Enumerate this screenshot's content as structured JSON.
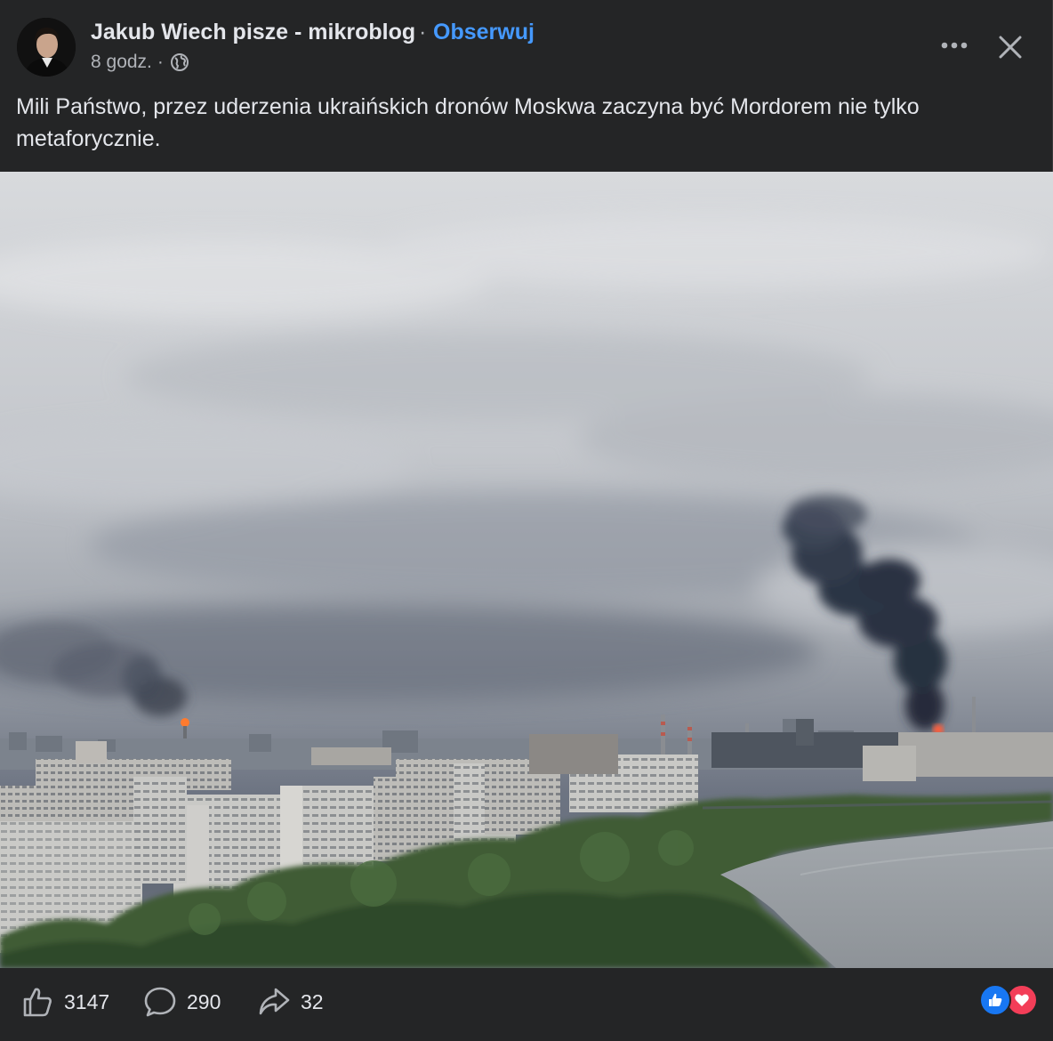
{
  "post": {
    "author": "Jakub Wiech pisze - mikroblog",
    "separator": "·",
    "follow_label": "Obserwuj",
    "time": "8 godz.",
    "meta_separator": "·",
    "audience_icon": "globe-icon",
    "text": "Mili Państwo, przez uderzenia ukraińskich dronów Moskwa zaczyna być Mordorem nie tylko metaforycznie."
  },
  "header_actions": {
    "more_icon": "more-options-icon",
    "close_icon": "close-icon"
  },
  "footer": {
    "likes": "3147",
    "comments": "290",
    "shares": "32",
    "like_icon": "thumbs-up-icon",
    "comment_icon": "comment-icon",
    "share_icon": "share-icon",
    "reaction_icons": [
      "like-reaction-icon",
      "love-reaction-icon"
    ]
  },
  "colors": {
    "background": "#242526",
    "text": "#e4e6eb",
    "secondary_text": "#b0b3b8",
    "follow_link": "#4599ff",
    "like_blue": "#1877f2",
    "love_red": "#f33e58"
  }
}
